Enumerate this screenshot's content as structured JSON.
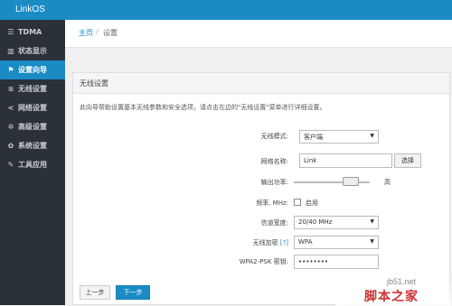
{
  "app": {
    "title": "LinkOS"
  },
  "sidebar": {
    "items": [
      {
        "label": "TDMA",
        "icon": "menu-lines-icon",
        "glyph": "☰"
      },
      {
        "label": "状态显示",
        "icon": "bar-chart-icon",
        "glyph": "▥"
      },
      {
        "label": "设置向导",
        "icon": "flag-icon",
        "glyph": "⚑",
        "active": true
      },
      {
        "label": "无线设置",
        "icon": "wifi-signal-icon",
        "glyph": "≋"
      },
      {
        "label": "网络设置",
        "icon": "share-icon",
        "glyph": "<"
      },
      {
        "label": "高级设置",
        "icon": "gear-icon",
        "glyph": "✲"
      },
      {
        "label": "系统设置",
        "icon": "gears-icon",
        "glyph": "✿"
      },
      {
        "label": "工具应用",
        "icon": "wrench-icon",
        "glyph": "✎"
      }
    ]
  },
  "breadcrumb": {
    "home": "主页",
    "separator": "/",
    "current": "设置"
  },
  "panel": {
    "title": "无线设置",
    "intro": "此向导帮助设置基本无线参数和安全选项，请点击左边的\"无线设置\"菜单进行详细设置。"
  },
  "form": {
    "mode": {
      "label": "无线模式:",
      "value": "客户端"
    },
    "ssid": {
      "label": "网络名称:",
      "value": "Link",
      "button": "选择"
    },
    "power": {
      "label": "输出功率:",
      "value_label": "高",
      "level": 0.82
    },
    "freq": {
      "label": "频率, MHz:",
      "checkbox_label": "启用",
      "checked": false
    },
    "width": {
      "label": "信道宽度:",
      "value": "20/40 MHz"
    },
    "security": {
      "label": "无线加密",
      "help": "[?]",
      "value": "WPA"
    },
    "psk": {
      "label": "WPA2-PSK 密钥:",
      "value": "••••••••"
    }
  },
  "actions": {
    "prev": "上一步",
    "next": "下一步"
  },
  "watermark": {
    "line1": "jb51.net",
    "line2": "脚本之家"
  },
  "colors": {
    "accent": "#1b8bc5",
    "sidebar_bg": "#2b3138",
    "watermark_red": "#cc3333"
  }
}
